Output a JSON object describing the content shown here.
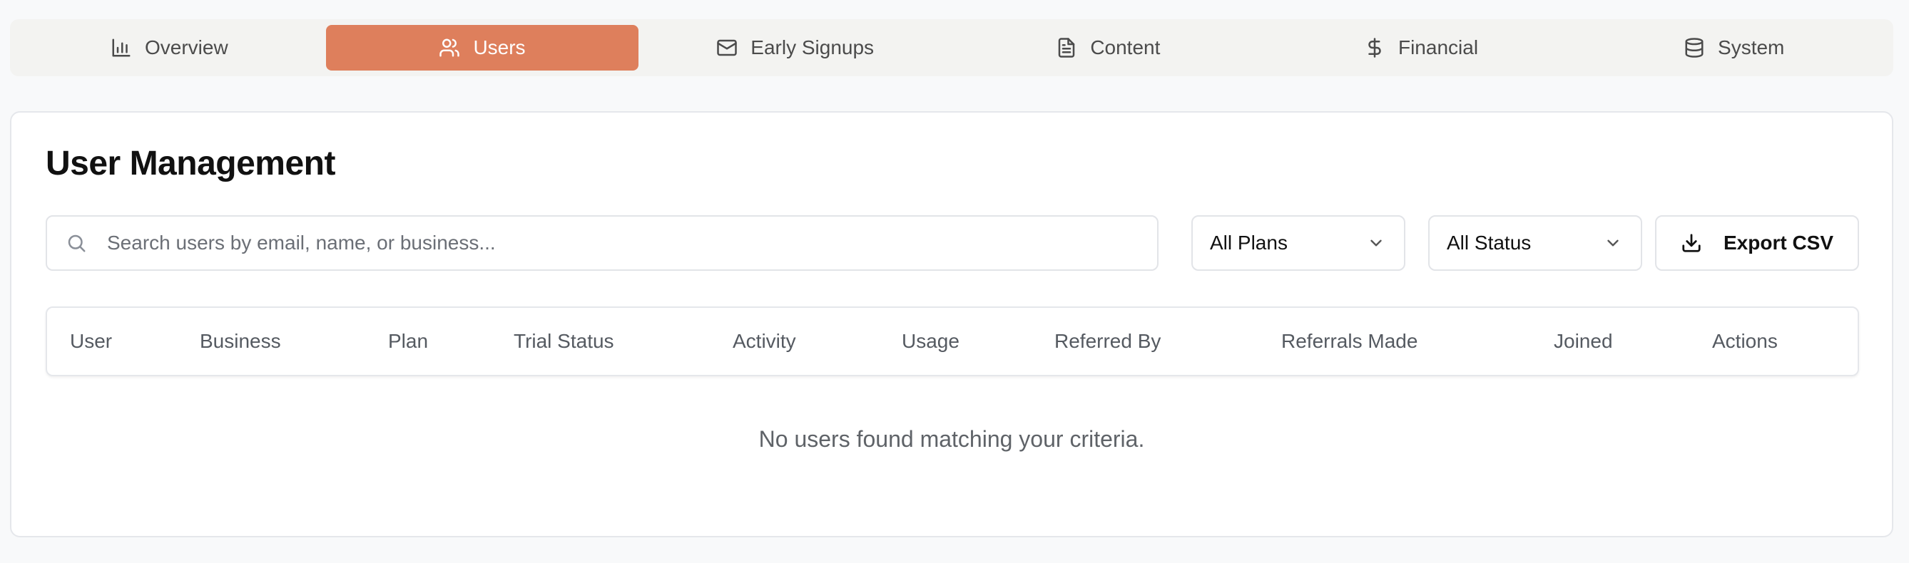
{
  "nav": {
    "tabs": [
      {
        "label": "Overview",
        "icon": "bar-chart-icon"
      },
      {
        "label": "Users",
        "icon": "users-icon",
        "active": true
      },
      {
        "label": "Early Signups",
        "icon": "mail-icon"
      },
      {
        "label": "Content",
        "icon": "file-text-icon"
      },
      {
        "label": "Financial",
        "icon": "dollar-icon"
      },
      {
        "label": "System",
        "icon": "database-icon"
      }
    ]
  },
  "main": {
    "title": "User Management",
    "search": {
      "placeholder": "Search users by email, name, or business...",
      "value": ""
    },
    "plan_filter": {
      "selected": "All Plans"
    },
    "status_filter": {
      "selected": "All Status"
    },
    "export_label": "Export CSV",
    "table": {
      "columns": [
        "User",
        "Business",
        "Plan",
        "Trial Status",
        "Activity",
        "Usage",
        "Referred By",
        "Referrals Made",
        "Joined",
        "Actions"
      ],
      "rows": [],
      "empty_message": "No users found matching your criteria."
    }
  },
  "colors": {
    "accent": "#de7f5c",
    "background": "#f8f9fa"
  }
}
